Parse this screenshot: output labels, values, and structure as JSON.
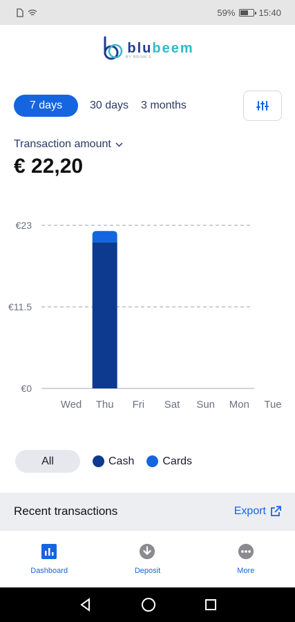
{
  "status": {
    "battery": "59%",
    "time": "15:40"
  },
  "brand": {
    "blu": "blu",
    "beem": "beem",
    "tagline": "BY BRINK'S"
  },
  "tabs": [
    {
      "label": "7 days",
      "active": true
    },
    {
      "label": "30 days",
      "active": false
    },
    {
      "label": "3 months",
      "active": false
    }
  ],
  "summary": {
    "label": "Transaction amount",
    "value": "€ 22,20"
  },
  "chart_data": {
    "type": "bar",
    "stacked": true,
    "categories": [
      "Wed",
      "Thu",
      "Fri",
      "Sat",
      "Sun",
      "Mon",
      "Tue"
    ],
    "series": [
      {
        "name": "Cash",
        "color": "#0d3a8f",
        "values": [
          0,
          20.6,
          0,
          0,
          0,
          0,
          0
        ]
      },
      {
        "name": "Cards",
        "color": "#1565e0",
        "values": [
          0,
          1.6,
          0,
          0,
          0,
          0,
          0
        ]
      }
    ],
    "yticks": [
      "€0",
      "€11.5",
      "€23"
    ],
    "ylim": [
      0,
      23
    ],
    "grid": "dashed"
  },
  "legend": {
    "all": "All",
    "cash": "Cash",
    "cards": "Cards",
    "cash_color": "#0d3a8f",
    "cards_color": "#1565e0"
  },
  "recent": {
    "title": "Recent transactions",
    "export": "Export"
  },
  "nav": {
    "dashboard": "Dashboard",
    "deposit": "Deposit",
    "more": "More"
  }
}
